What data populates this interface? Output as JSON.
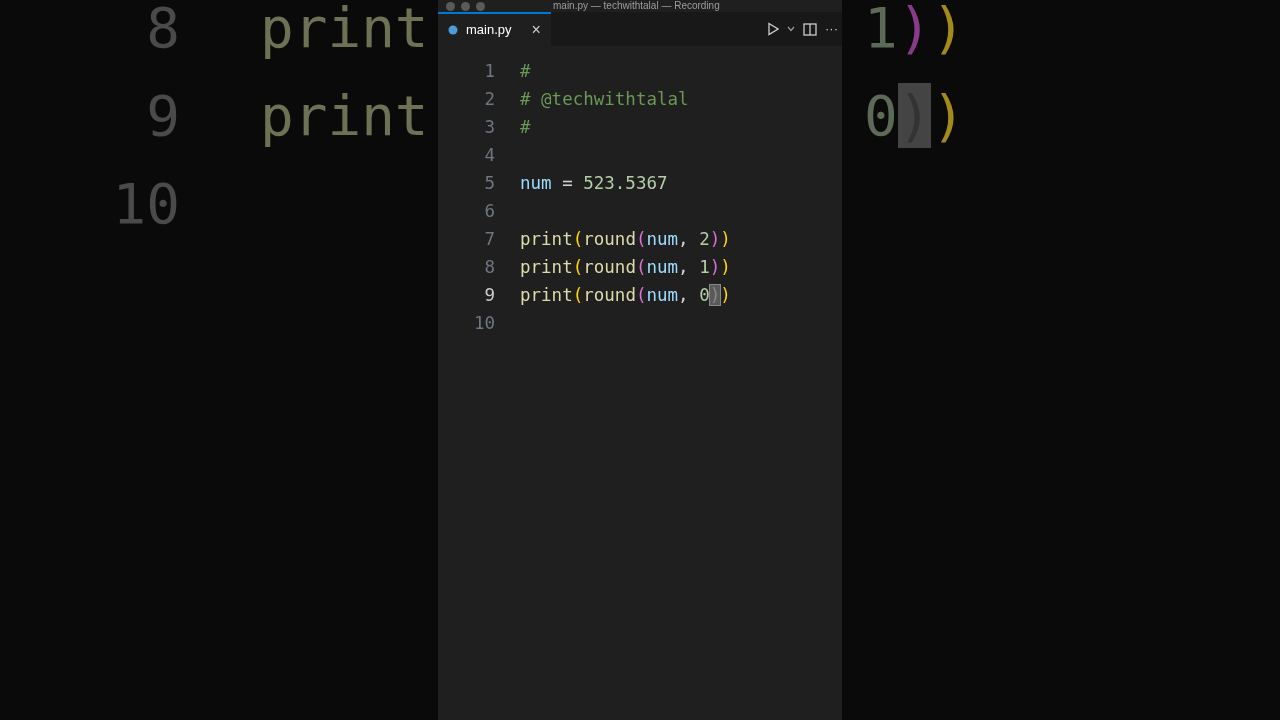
{
  "window": {
    "title": "main.py — techwithtalal — Recording"
  },
  "tabs": [
    {
      "label": "main.py",
      "selected": true,
      "close": "×"
    }
  ],
  "editor_actions": {
    "more": "···"
  },
  "editor": {
    "lines": [
      {
        "number": "1",
        "active": false,
        "tokens": [
          {
            "kind": "comment",
            "text": "#"
          }
        ]
      },
      {
        "number": "2",
        "active": false,
        "tokens": [
          {
            "kind": "comment",
            "text": "# @techwithtalal"
          }
        ]
      },
      {
        "number": "3",
        "active": false,
        "tokens": [
          {
            "kind": "comment",
            "text": "#"
          }
        ]
      },
      {
        "number": "4",
        "active": false
      },
      {
        "number": "5",
        "active": false,
        "tokens": [
          {
            "kind": "variable",
            "text": "num"
          },
          {
            "kind": "plain",
            "text": " = "
          },
          {
            "kind": "number",
            "text": "523.5367"
          }
        ]
      },
      {
        "number": "6",
        "active": false
      },
      {
        "number": "7",
        "active": false,
        "tokens": [
          {
            "kind": "function",
            "text": "print"
          },
          {
            "kind": "bracket1",
            "text": "("
          },
          {
            "kind": "function",
            "text": "round"
          },
          {
            "kind": "bracket2",
            "text": "("
          },
          {
            "kind": "variable",
            "text": "num"
          },
          {
            "kind": "plain",
            "text": ", "
          },
          {
            "kind": "number",
            "text": "2"
          },
          {
            "kind": "bracket2",
            "text": ")"
          },
          {
            "kind": "bracket1",
            "text": ")"
          }
        ]
      },
      {
        "number": "8",
        "active": false,
        "tokens": [
          {
            "kind": "function",
            "text": "print"
          },
          {
            "kind": "bracket1",
            "text": "("
          },
          {
            "kind": "function",
            "text": "round"
          },
          {
            "kind": "bracket2",
            "text": "("
          },
          {
            "kind": "variable",
            "text": "num"
          },
          {
            "kind": "plain",
            "text": ", "
          },
          {
            "kind": "number",
            "text": "1"
          },
          {
            "kind": "bracket2",
            "text": ")"
          },
          {
            "kind": "bracket1",
            "text": ")"
          }
        ]
      },
      {
        "number": "9",
        "active": true,
        "tokens": [
          {
            "kind": "function",
            "text": "print"
          },
          {
            "kind": "bracket1",
            "text": "("
          },
          {
            "kind": "function",
            "text": "round"
          },
          {
            "kind": "bracket2",
            "text": "("
          },
          {
            "kind": "variable",
            "text": "num"
          },
          {
            "kind": "plain",
            "text": ", "
          },
          {
            "kind": "number",
            "text": "0"
          },
          {
            "kind": "bracket2",
            "text": ")",
            "highlighted": true
          },
          {
            "kind": "bracket1",
            "text": ")"
          }
        ]
      },
      {
        "number": "10",
        "active": false
      }
    ]
  },
  "backdrop": {
    "left": [
      {
        "number": "8",
        "code": "print"
      },
      {
        "number": "9",
        "code": "print"
      },
      {
        "number": "10"
      }
    ],
    "right": [
      [
        {
          "kind": "number",
          "text": "1"
        },
        {
          "kind": "bracket2",
          "text": ")"
        },
        {
          "kind": "bracket1",
          "text": ")"
        }
      ],
      [
        {
          "kind": "number",
          "text": "0"
        },
        {
          "kind": "bracket2",
          "text": ")",
          "highlighted": true
        },
        {
          "kind": "bracket1",
          "text": ")"
        }
      ]
    ]
  }
}
